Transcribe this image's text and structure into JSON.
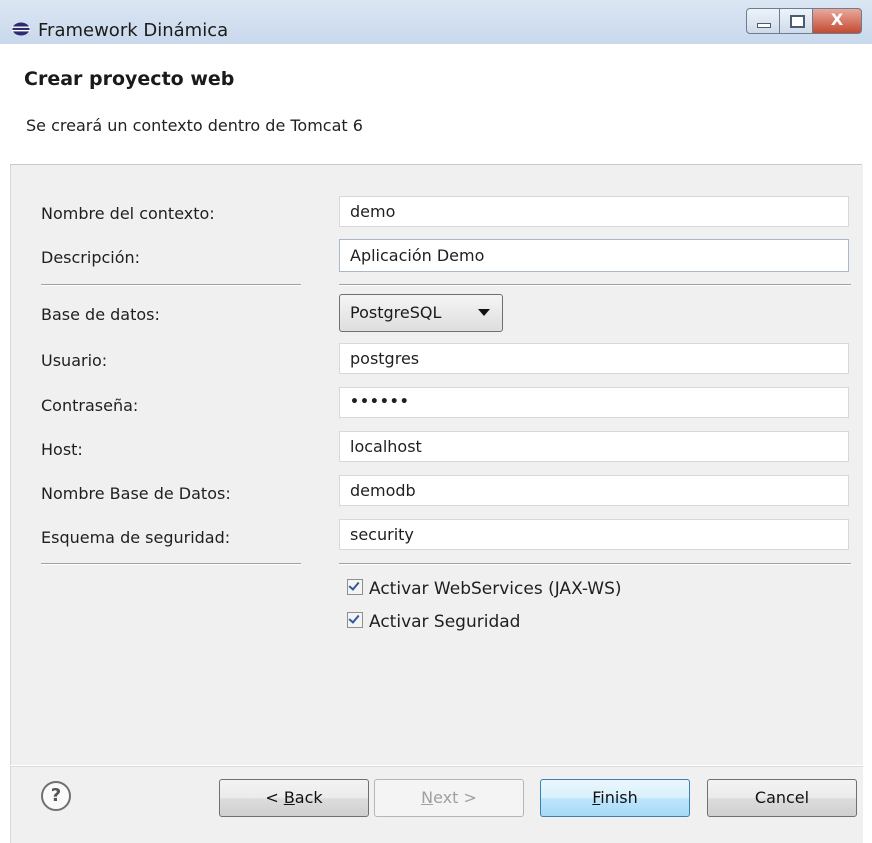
{
  "window": {
    "title": "Framework Dinámica",
    "controls": {
      "minimize": "—",
      "maximize": "☐",
      "close": "X"
    }
  },
  "header": {
    "title": "Crear proyecto web",
    "description": "Se creará un contexto dentro de Tomcat 6"
  },
  "form": {
    "context_name": {
      "label": "Nombre del contexto:",
      "value": "demo"
    },
    "description": {
      "label": "Descripción:",
      "value": "Aplicación Demo"
    },
    "database": {
      "label": "Base de datos:",
      "value": "PostgreSQL"
    },
    "user": {
      "label": "Usuario:",
      "value": "postgres"
    },
    "password": {
      "label": "Contraseña:",
      "value": "••••••"
    },
    "host": {
      "label": "Host:",
      "value": "localhost"
    },
    "db_name": {
      "label": "Nombre Base de Datos:",
      "value": "demodb"
    },
    "security_schema": {
      "label": "Esquema de seguridad:",
      "value": "security"
    },
    "checkboxes": {
      "webservices": {
        "label": "Activar WebServices (JAX-WS)",
        "checked": true
      },
      "security": {
        "label": "Activar Seguridad",
        "checked": true
      }
    }
  },
  "buttons": {
    "help": "?",
    "back": {
      "prefix": "< ",
      "mnemonic": "B",
      "rest": "ack"
    },
    "next": {
      "mnemonic": "N",
      "rest": "ext >"
    },
    "finish": {
      "mnemonic": "F",
      "rest": "inish"
    },
    "cancel": "Cancel"
  },
  "colors": {
    "titlebar": "#c9d8ec",
    "panel": "#f0f0f0",
    "default_button": "#bee6fd"
  }
}
